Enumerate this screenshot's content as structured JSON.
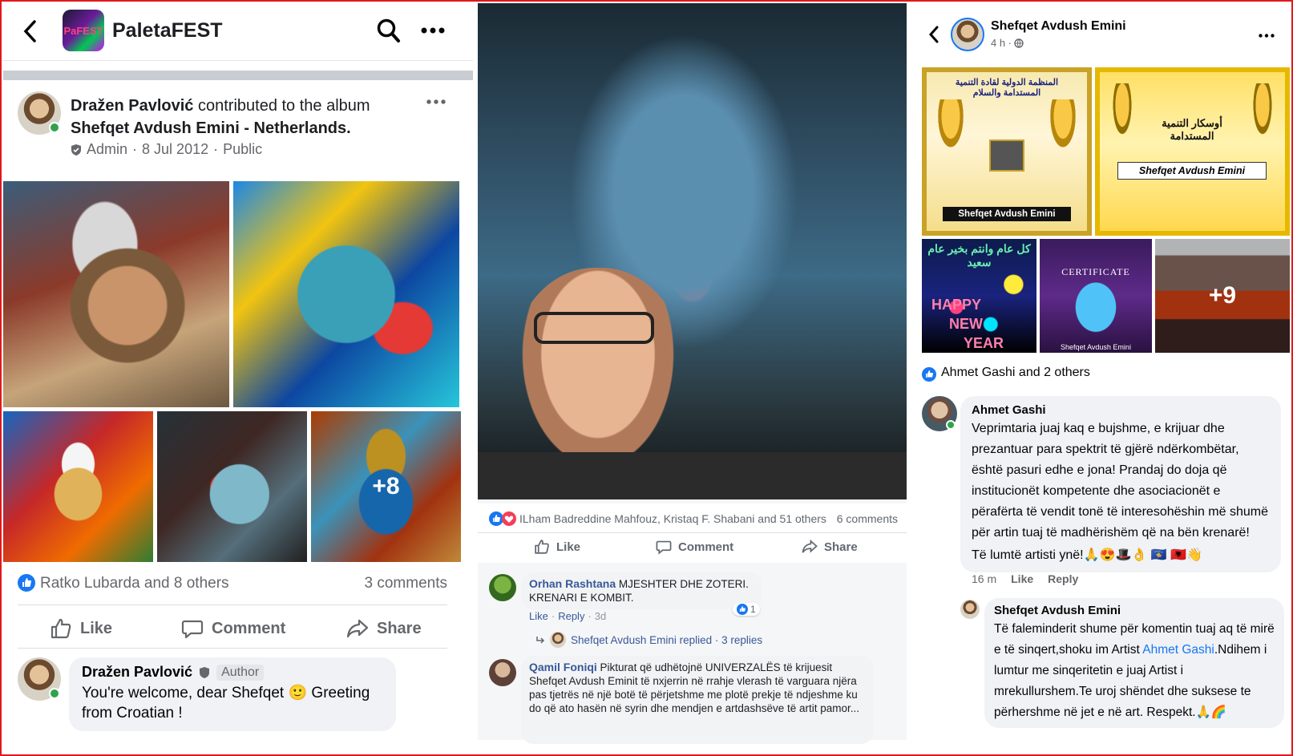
{
  "left_panel": {
    "page_name": "PaletaFEST",
    "logo_text": "PaFEST",
    "post": {
      "author": "Dražen Pavlović",
      "action_text": "contributed to the album",
      "album": "Shefqet Avdush Emini - Netherlands.",
      "role": "Admin",
      "date": "8 Jul 2012",
      "audience": "Public",
      "more_photos": "+8",
      "reactions": "Ratko Lubarda and 8 others",
      "comments_count": "3 comments",
      "like_label": "Like",
      "comment_label": "Comment",
      "share_label": "Share"
    },
    "comment": {
      "author": "Dražen Pavlović",
      "badge": "Author",
      "text": "You're welcome, dear Shefqet 🙂 Greeting from Croatian !"
    }
  },
  "middle_panel": {
    "reactions": "ILham Badreddine Mahfouz, Kristaq F. Shabani and 51 others",
    "comments_count": "6 comments",
    "like_label": "Like",
    "comment_label": "Comment",
    "share_label": "Share",
    "comments": [
      {
        "author": "Orhan Rashtana",
        "text": "MJESHTER DHE ZOTERI. KRENARI E KOMBIT.",
        "like": "Like",
        "reply": "Reply",
        "time": "3d",
        "reaction_count": "1",
        "replied_text": "Shefqet Avdush Emini replied · 3 replies"
      },
      {
        "author": "Qamil Foniqi",
        "text": "Pikturat që udhëtojnë UNIVERZALËS të krijuesit Shefqet Avdush Eminit të nxjerrin në rrahje vlerash të varguara njëra pas tjetrës në një botë të përjetshme me plotë prekje të ndjeshme ku do që ato hasën në syrin dhe mendjen e artdashsëve të artit pamor..."
      }
    ]
  },
  "right_panel": {
    "header": {
      "name": "Shefqet Avdush Emini",
      "time": "4 h ·"
    },
    "cert1": {
      "title": "المنظمة الدولية لقادة التنمية المستدامة والسلام",
      "name": "Shefqet Avdush Emini"
    },
    "cert2": {
      "title": "أوسكار التنمية المستدامة",
      "name": "Shefqet Avdush Emini"
    },
    "thumb1": {
      "top": "كل عام وانتم بخير عام سعيد",
      "happy": "HAPPY",
      "new": "NEW",
      "year": "YEAR"
    },
    "thumb2": {
      "title": "CERTIFICATE",
      "name": "Shefqet Avdush Emini"
    },
    "thumb3": {
      "more": "+9"
    },
    "reactions": "Ahmet Gashi and 2 others",
    "comment1": {
      "author": "Ahmet Gashi",
      "text": "Veprimtaria juaj kaq e bujshme, e krijuar dhe prezantuar para spektrit të gjërë ndërkombëtar, është pasuri edhe e jona! Prandaj do doja që institucionët kompetente dhe asociacionët e përafërta të vendit tonë të interesohëshin më shumë për artin tuaj të madhërishëm që na bën krenarë!",
      "closing": "Të lumtë artisti ynë!🙏😍🎩👌 🇽🇰 🇦🇱👋",
      "time": "16 m",
      "like": "Like",
      "reply": "Reply"
    },
    "comment2": {
      "author": "Shefqet Avdush Emini",
      "text_a": "Të faleminderit shume për komentin tuaj aq të mirë e të  sinqert,shoku im Artist",
      "mention": "Ahmet Gashi",
      "text_b": ".Ndihem i lumtur me sinqeritetin e juaj Artist i mrekullurshem.Te uroj shëndet dhe suksese te përhershme në jet e në art. Respekt.🙏🌈"
    }
  },
  "colors": {
    "facebook_blue": "#1877f2",
    "link_blue": "#385898",
    "online_green": "#31a24c",
    "frame_red": "#e0191d"
  }
}
